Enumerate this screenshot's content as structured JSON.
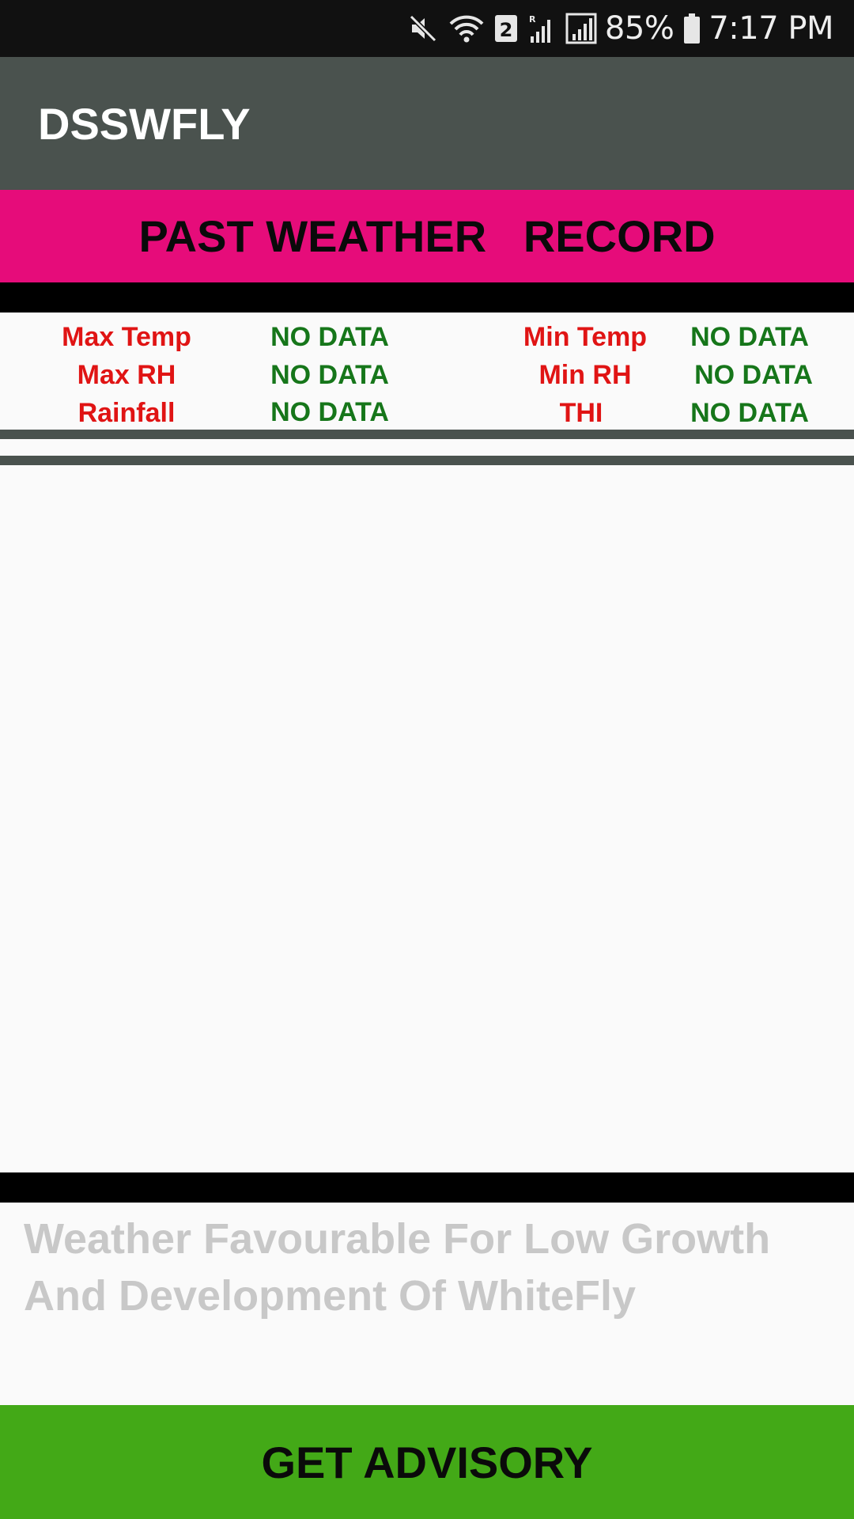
{
  "status_bar": {
    "icons": [
      "mute-icon",
      "wifi-icon",
      "sim-2-icon",
      "roaming-signal-icon",
      "signal-icon",
      "battery-icon"
    ],
    "sim_badge": "2",
    "battery": "85%",
    "time": "7:17 PM"
  },
  "app_bar": {
    "title": "DSSWFLY"
  },
  "banner": {
    "title": "PAST WEATHER   RECORD"
  },
  "weather": {
    "left": [
      {
        "label": "Max Temp",
        "value": "NO DATA"
      },
      {
        "label": "Max RH",
        "value": "NO DATA"
      },
      {
        "label": "Rainfall",
        "value": "NO DATA"
      }
    ],
    "right": [
      {
        "label": "Min Temp",
        "value": "NO DATA"
      },
      {
        "label": "Min RH",
        "value": "NO DATA"
      },
      {
        "label": "THI",
        "value": "NO DATA"
      }
    ]
  },
  "message": "Weather Favourable For Low Growth And Development Of WhiteFly",
  "button": {
    "label": "GET ADVISORY"
  },
  "colors": {
    "app_bar": "#4a524e",
    "banner": "#e60c7a",
    "label_red": "#e01414",
    "value_green": "#16761a",
    "button_green": "#43a917"
  }
}
